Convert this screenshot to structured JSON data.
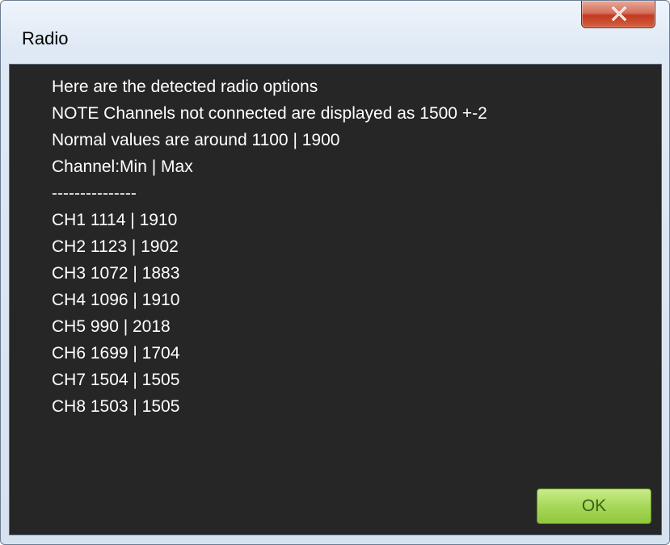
{
  "window": {
    "title": "Radio",
    "close_icon": "close-icon"
  },
  "message": {
    "lines": [
      "Here are the detected radio options",
      "NOTE Channels not connected are displayed as 1500 +-2",
      "Normal values are around 1100 | 1900",
      "Channel:Min | Max",
      "---------------",
      "CH1 1114 | 1910",
      "CH2 1123 | 1902",
      "CH3 1072 | 1883",
      "CH4 1096 | 1910",
      "CH5 990 | 2018",
      "CH6 1699 | 1704",
      "CH7 1504 | 1505",
      "CH8 1503 | 1505"
    ]
  },
  "buttons": {
    "ok_label": "OK"
  },
  "colors": {
    "dialog_background": "#262626",
    "text": "#ffffff",
    "ok_button": "#a6d85a",
    "close_button": "#c23a22"
  }
}
